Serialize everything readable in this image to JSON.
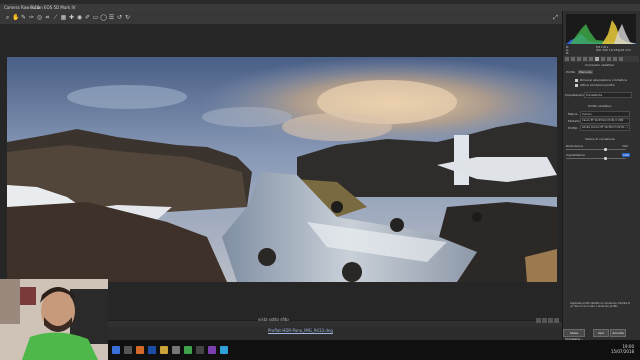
{
  "app": {
    "title": "Camera Raw 9.10",
    "camera": "Canon EOS 5D Mark IV"
  },
  "toolbar": {
    "tools": [
      "zoom-icon",
      "hand-icon",
      "white-balance-icon",
      "color-sampler-icon",
      "target-adjust-icon",
      "crop-icon",
      "straighten-icon",
      "transform-icon",
      "spot-removal-icon",
      "red-eye-icon",
      "brush-icon",
      "graduated-filter-icon",
      "radial-filter-icon",
      "preferences-icon",
      "rotate-left-icon",
      "rotate-right-icon"
    ]
  },
  "canvas": {
    "caption": "vista sotto sfdp",
    "filename": "Proflat-HDR-Pano_IMG_9433.dng"
  },
  "right_panel": {
    "readout_left": [
      "R:",
      "G:",
      "B:"
    ],
    "readout_right": [
      "f/8   1/8 s",
      "ISO 100   16-35@16 mm"
    ],
    "section_title": "Correzioni obiettivo",
    "tabs": [
      "Profilo",
      "Manuale"
    ],
    "checkboxes": [
      "Rimuovi aberrazione cromatica",
      "Attiva correzioni profilo"
    ],
    "setup_label": "Impostazione:",
    "setup_value": "Predefinite",
    "profile_heading": "Profilo obiettivo",
    "make_label": "Marca:",
    "make_value": "Canon",
    "model_label": "Modello:",
    "model_value": "Canon EF 16-35mm f/2.8L II USM",
    "profile_label": "Profilo:",
    "profile_value": "Adobe (Canon EF 16-35mm f/2.8L...)",
    "correction_heading": "Valore di correzione",
    "distortion_label": "Distorsione",
    "distortion_value": "100",
    "vignetting_label": "Vignettatura",
    "vignetting_value": "100",
    "note_text": "Applicate profili obiettivi e correzione. Facilita di un ritocco di un sito o lente più profilo",
    "button_save": "Salva immagine...",
    "button_open": "Apri",
    "button_cancel": "Annulla"
  },
  "taskbar": {
    "time": "19:00",
    "date": "15/07/2018"
  }
}
